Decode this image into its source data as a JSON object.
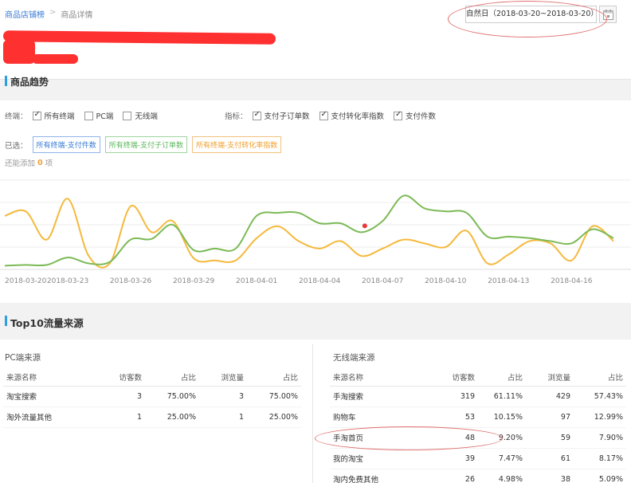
{
  "breadcrumb": {
    "home": "商品店铺榜",
    "sep": ">",
    "current": "商品详情"
  },
  "date_picker": {
    "value": "自然日（2018-03-20~2018-03-20）"
  },
  "trend": {
    "title": "商品趋势",
    "terminal_label": "终端：",
    "terminals": [
      {
        "label": "所有终端",
        "checked": true
      },
      {
        "label": "PC端",
        "checked": false
      },
      {
        "label": "无线端",
        "checked": false
      }
    ],
    "metric_label": "指标：",
    "metrics": [
      {
        "label": "支付子订单数",
        "checked": true
      },
      {
        "label": "支付转化率指数",
        "checked": true
      },
      {
        "label": "支付件数",
        "checked": true
      }
    ],
    "selected_label": "已选：",
    "selected_tags": [
      "所有终端-支付件数",
      "所有终端-支付子订单数",
      "所有终端-支付转化率指数"
    ],
    "remaining_prefix": "还能添加",
    "remaining_count": "0",
    "remaining_suffix": "项"
  },
  "chart_data": {
    "type": "line",
    "x": [
      "2018-03-20",
      "2018-03-21",
      "2018-03-22",
      "2018-03-23",
      "2018-03-24",
      "2018-03-25",
      "2018-03-26",
      "2018-03-27",
      "2018-03-28",
      "2018-03-29",
      "2018-03-30",
      "2018-03-31",
      "2018-04-01",
      "2018-04-02",
      "2018-04-03",
      "2018-04-04",
      "2018-04-05",
      "2018-04-06",
      "2018-04-07",
      "2018-04-08",
      "2018-04-09",
      "2018-04-10",
      "2018-04-11",
      "2018-04-12",
      "2018-04-13",
      "2018-04-14",
      "2018-04-15",
      "2018-04-16",
      "2018-04-17",
      "2018-04-18"
    ],
    "xticks": [
      "2018-03-20",
      "2018-03-23",
      "2018-03-26",
      "2018-03-29",
      "2018-04-01",
      "2018-04-04",
      "2018-04-07",
      "2018-04-10",
      "2018-04-13",
      "2018-04-16"
    ],
    "ylim": [
      0,
      120
    ],
    "grid": true,
    "series": [
      {
        "color": "#f5b93c",
        "values": [
          72,
          78,
          40,
          95,
          18,
          8,
          85,
          50,
          65,
          15,
          12,
          12,
          42,
          58,
          38,
          28,
          38,
          18,
          28,
          40,
          35,
          30,
          52,
          8,
          20,
          38,
          35,
          12,
          58,
          38
        ]
      },
      {
        "color": "#7cba56",
        "values": [
          5,
          6,
          6,
          16,
          8,
          10,
          40,
          41,
          60,
          26,
          28,
          28,
          72,
          76,
          76,
          62,
          62,
          50,
          65,
          99,
          82,
          78,
          76,
          44,
          44,
          42,
          38,
          35,
          54,
          42
        ]
      }
    ]
  },
  "traffic": {
    "title": "Top10流量来源",
    "pc": {
      "title": "PC端来源",
      "headers": [
        "来源名称",
        "访客数",
        "占比",
        "浏览量",
        "占比"
      ],
      "rows": [
        [
          "淘宝搜索",
          "3",
          "75.00%",
          "3",
          "75.00%"
        ],
        [
          "淘外流量其他",
          "1",
          "25.00%",
          "1",
          "25.00%"
        ]
      ]
    },
    "wireless": {
      "title": "无线端来源",
      "headers": [
        "来源名称",
        "访客数",
        "占比",
        "浏览量",
        "占比"
      ],
      "rows": [
        [
          "手淘搜索",
          "319",
          "61.11%",
          "429",
          "57.43%"
        ],
        [
          "购物车",
          "53",
          "10.15%",
          "97",
          "12.99%"
        ],
        [
          "手淘首页",
          "48",
          "9.20%",
          "59",
          "7.90%"
        ],
        [
          "我的淘宝",
          "39",
          "7.47%",
          "61",
          "8.17%"
        ],
        [
          "淘内免费其他",
          "26",
          "4.98%",
          "38",
          "5.09%"
        ]
      ]
    }
  }
}
